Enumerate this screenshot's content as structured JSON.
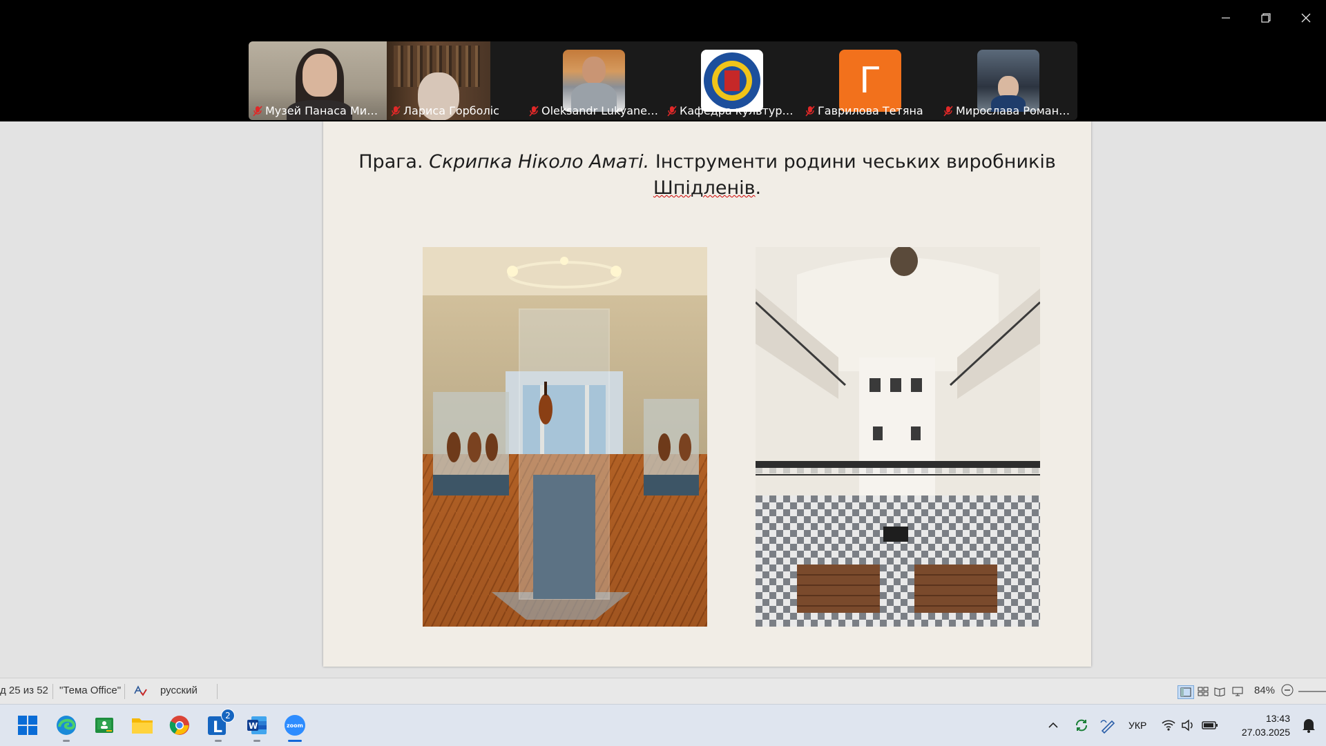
{
  "window_controls": {
    "minimize": "minimize-icon",
    "restore": "restore-icon",
    "close": "close-icon"
  },
  "participants": [
    {
      "name": "Музей Панаса Мирно...",
      "muted": true,
      "kind": "video"
    },
    {
      "name": "Лариса Горболіс",
      "muted": true,
      "kind": "video"
    },
    {
      "name": "Oleksandr Lukyanenko",
      "muted": true,
      "kind": "avatar"
    },
    {
      "name": "Кафедра культурологі...",
      "muted": true,
      "kind": "avatar"
    },
    {
      "name": "Гаврилова Тетяна",
      "muted": true,
      "kind": "letter",
      "letter": "Г",
      "color": "#f2711c"
    },
    {
      "name": "Мирослава Романенко",
      "muted": true,
      "kind": "avatar"
    }
  ],
  "slide": {
    "title_part1": "Прага. ",
    "title_italic": "Скрипка Ніколо Аматі.",
    "title_part2": " Інструменти родини чеських виробників ",
    "title_underlined": "Шпідленів",
    "title_end": "."
  },
  "statusbar": {
    "slide_counter": "д 25 из 52",
    "theme": "\"Тема Office\"",
    "language": "русский",
    "zoom": "84%"
  },
  "taskbar": {
    "apps": [
      "windows-start",
      "edge",
      "classroom",
      "file-explorer",
      "chrome",
      "l-app",
      "word",
      "zoom"
    ],
    "l_badge": "2",
    "keyboard": "УКР",
    "time": "13:43",
    "date": "27.03.2025"
  },
  "colors": {
    "accent": "#1067d8",
    "zoom": "#2d8cff",
    "orange_avatar": "#f2711c"
  }
}
